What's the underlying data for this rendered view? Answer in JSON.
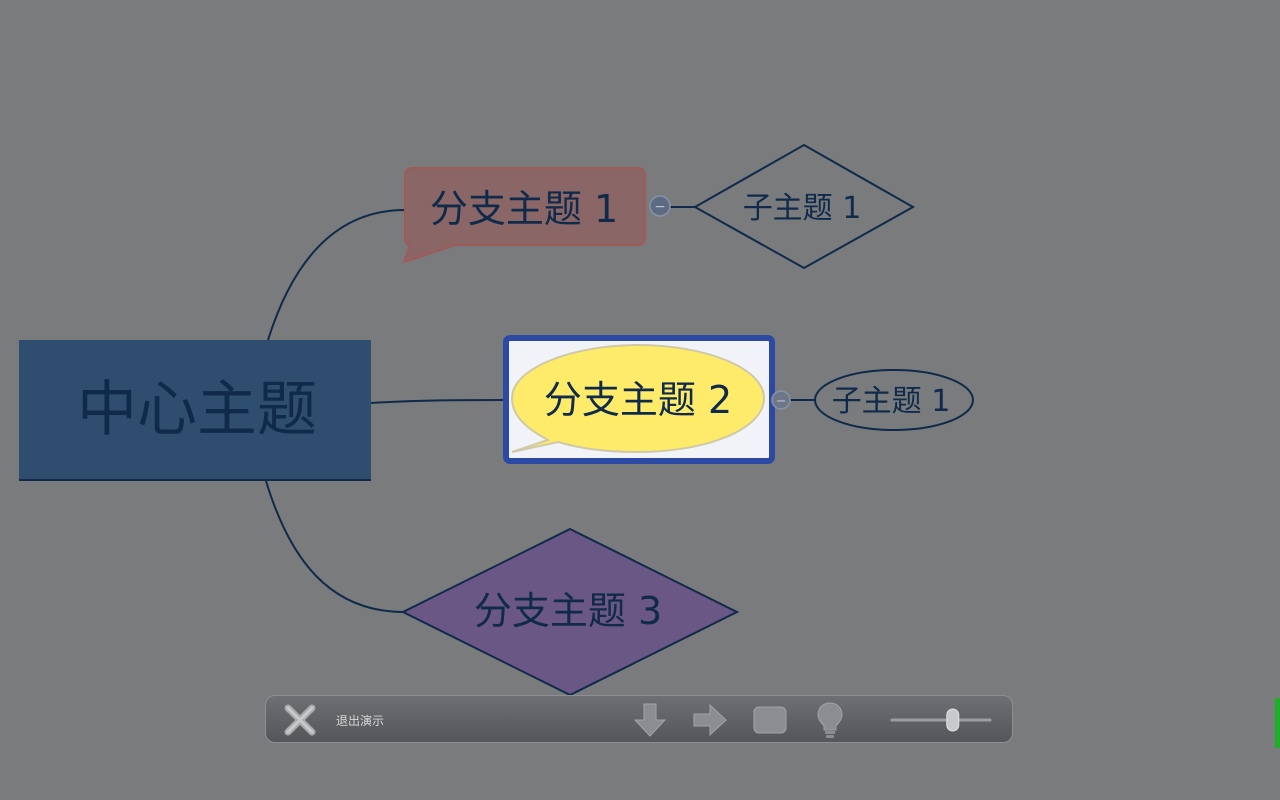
{
  "mindmap": {
    "central_topic": "中心主题",
    "branches": [
      {
        "label": "分支主题 1",
        "subtopic": "子主题 1"
      },
      {
        "label": "分支主题 2",
        "subtopic": "子主题 1"
      },
      {
        "label": "分支主题 3"
      }
    ],
    "collapse_glyph": "−"
  },
  "toolbar": {
    "exit_label": "退出演示",
    "icons": {
      "exit": "close-x-icon",
      "down": "arrow-down-icon",
      "right": "arrow-right-icon",
      "frame": "rectangle-icon",
      "hint": "lightbulb-icon"
    },
    "zoom_level": 0.62
  },
  "colors": {
    "background": "#7a7b7d",
    "central_fill": "#2f4e6f",
    "branch1_fill": "#8a6766",
    "branch2_fill": "#ffeb6a",
    "branch2_selection": "#2c4aa3",
    "branch3_fill": "#6a5785",
    "text": "#0f2a4a",
    "line": "#0f2a4a"
  }
}
